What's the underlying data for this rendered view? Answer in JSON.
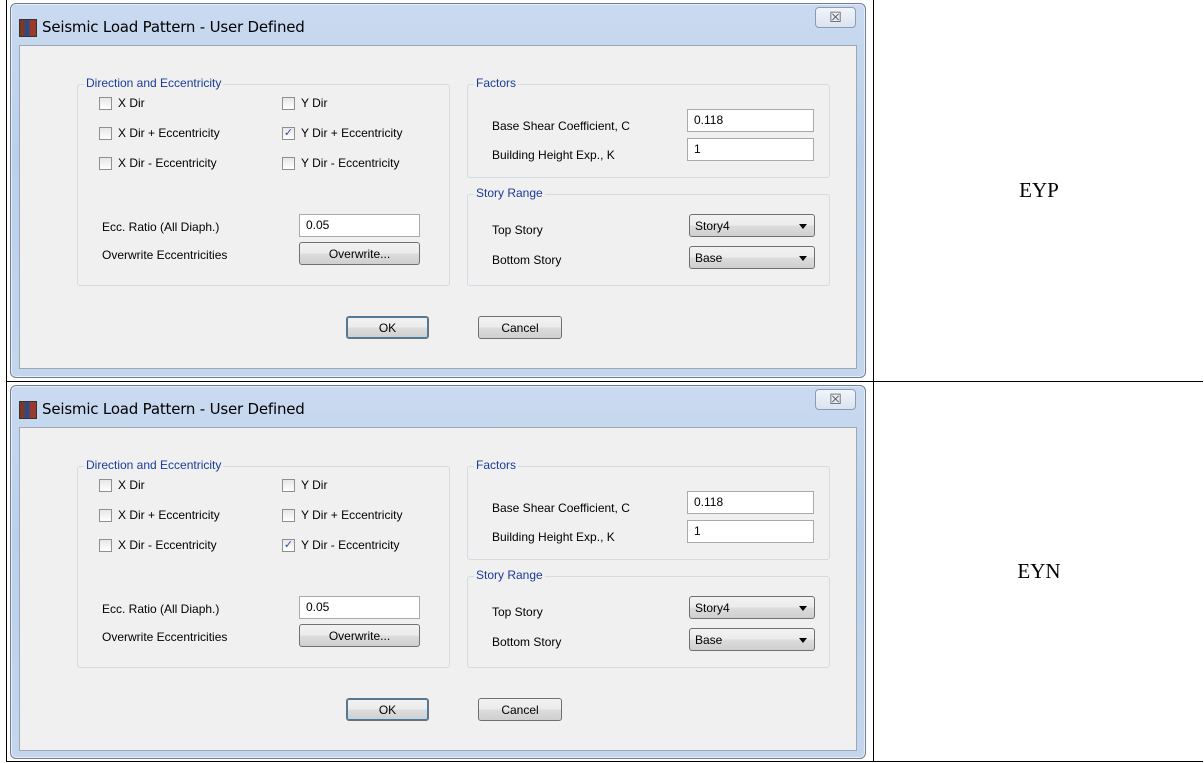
{
  "rows": [
    {
      "label": "EYP",
      "dialog": {
        "title": "Seismic Load Pattern - User Defined",
        "close_glyph": "☒",
        "direction_group": {
          "title": "Direction and Eccentricity",
          "checkboxes": [
            {
              "label": "X Dir",
              "checked": false
            },
            {
              "label": "Y Dir",
              "checked": false
            },
            {
              "label": "X Dir + Eccentricity",
              "checked": false
            },
            {
              "label": "Y Dir + Eccentricity",
              "checked": true
            },
            {
              "label": "X Dir - Eccentricity",
              "checked": false
            },
            {
              "label": "Y Dir - Eccentricity",
              "checked": false
            }
          ],
          "ecc_ratio_label": "Ecc. Ratio (All Diaph.)",
          "ecc_ratio_value": "0.05",
          "overwrite_label": "Overwrite Eccentricities",
          "overwrite_button": "Overwrite..."
        },
        "factors_group": {
          "title": "Factors",
          "base_shear_label": "Base Shear Coefficient, C",
          "base_shear_value": "0.118",
          "height_exp_label": "Building Height Exp., K",
          "height_exp_value": "1"
        },
        "story_group": {
          "title": "Story Range",
          "top_label": "Top Story",
          "top_value": "Story4",
          "bottom_label": "Bottom Story",
          "bottom_value": "Base"
        },
        "ok_button": "OK",
        "cancel_button": "Cancel"
      }
    },
    {
      "label": "EYN",
      "dialog": {
        "title": "Seismic Load Pattern - User Defined",
        "close_glyph": "☒",
        "direction_group": {
          "title": "Direction and Eccentricity",
          "checkboxes": [
            {
              "label": "X Dir",
              "checked": false
            },
            {
              "label": "Y Dir",
              "checked": false
            },
            {
              "label": "X Dir + Eccentricity",
              "checked": false
            },
            {
              "label": "Y Dir + Eccentricity",
              "checked": false
            },
            {
              "label": "X Dir - Eccentricity",
              "checked": false
            },
            {
              "label": "Y Dir - Eccentricity",
              "checked": true
            }
          ],
          "ecc_ratio_label": "Ecc. Ratio (All Diaph.)",
          "ecc_ratio_value": "0.05",
          "overwrite_label": "Overwrite Eccentricities",
          "overwrite_button": "Overwrite..."
        },
        "factors_group": {
          "title": "Factors",
          "base_shear_label": "Base Shear Coefficient, C",
          "base_shear_value": "0.118",
          "height_exp_label": "Building Height Exp., K",
          "height_exp_value": "1"
        },
        "story_group": {
          "title": "Story Range",
          "top_label": "Top Story",
          "top_value": "Story4",
          "bottom_label": "Bottom Story",
          "bottom_value": "Base"
        },
        "ok_button": "OK",
        "cancel_button": "Cancel"
      }
    }
  ]
}
